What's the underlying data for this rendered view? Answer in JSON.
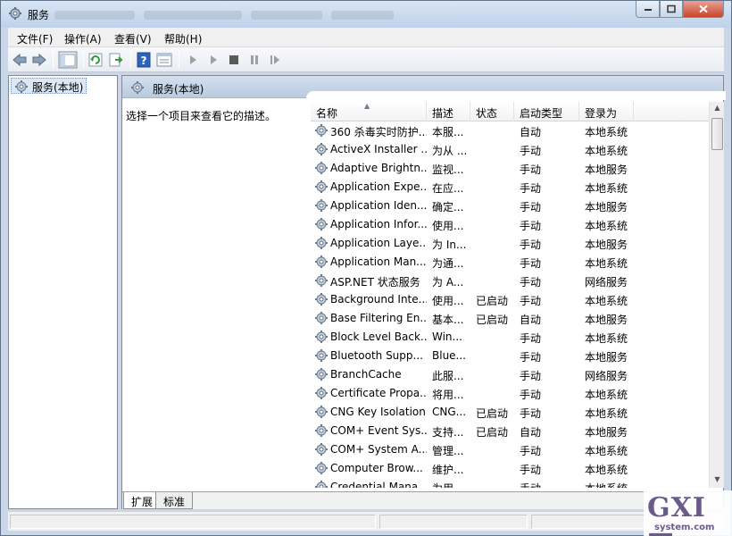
{
  "window": {
    "title": "服务"
  },
  "menu": [
    "文件(F)",
    "操作(A)",
    "查看(V)",
    "帮助(H)"
  ],
  "toolbar": [
    "back-icon",
    "forward-icon",
    "show-hide-console-tree-icon",
    "refresh-icon",
    "export-list-icon",
    "help-icon",
    "properties-icon",
    "start-service-icon",
    "start-service-alt-icon",
    "stop-service-icon",
    "pause-service-icon",
    "resume-service-icon"
  ],
  "tree": {
    "root_label": "服务(本地)"
  },
  "panel": {
    "title": "服务(本地)",
    "description_hint": "选择一个项目来查看它的描述。"
  },
  "columns": {
    "name": "名称",
    "desc": "描述",
    "status": "状态",
    "startup": "启动类型",
    "logon": "登录为"
  },
  "services": [
    {
      "name": "360 杀毒实时防护...",
      "desc": "本服...",
      "status": "",
      "startup": "自动",
      "logon": "本地系统"
    },
    {
      "name": "ActiveX Installer ...",
      "desc": "为从 ...",
      "status": "",
      "startup": "手动",
      "logon": "本地系统"
    },
    {
      "name": "Adaptive Brightn...",
      "desc": "监视...",
      "status": "",
      "startup": "手动",
      "logon": "本地服务"
    },
    {
      "name": "Application Expe...",
      "desc": "在应...",
      "status": "",
      "startup": "手动",
      "logon": "本地系统"
    },
    {
      "name": "Application Iden...",
      "desc": "确定...",
      "status": "",
      "startup": "手动",
      "logon": "本地服务"
    },
    {
      "name": "Application Infor...",
      "desc": "使用...",
      "status": "",
      "startup": "手动",
      "logon": "本地系统"
    },
    {
      "name": "Application Laye...",
      "desc": "为 In...",
      "status": "",
      "startup": "手动",
      "logon": "本地服务"
    },
    {
      "name": "Application Man...",
      "desc": "为通...",
      "status": "",
      "startup": "手动",
      "logon": "本地系统"
    },
    {
      "name": "ASP.NET 状态服务",
      "desc": "为 A...",
      "status": "",
      "startup": "手动",
      "logon": "网络服务"
    },
    {
      "name": "Background Inte...",
      "desc": "使用...",
      "status": "已启动",
      "startup": "手动",
      "logon": "本地系统"
    },
    {
      "name": "Base Filtering En...",
      "desc": "基本...",
      "status": "已启动",
      "startup": "自动",
      "logon": "本地服务"
    },
    {
      "name": "Block Level Back...",
      "desc": "Win...",
      "status": "",
      "startup": "手动",
      "logon": "本地系统"
    },
    {
      "name": "Bluetooth Supp...",
      "desc": "Blue...",
      "status": "",
      "startup": "手动",
      "logon": "本地服务"
    },
    {
      "name": "BranchCache",
      "desc": "此服...",
      "status": "",
      "startup": "手动",
      "logon": "网络服务"
    },
    {
      "name": "Certificate Propa...",
      "desc": "将用...",
      "status": "",
      "startup": "手动",
      "logon": "本地系统"
    },
    {
      "name": "CNG Key Isolation",
      "desc": "CNG...",
      "status": "已启动",
      "startup": "手动",
      "logon": "本地系统"
    },
    {
      "name": "COM+ Event Sys...",
      "desc": "支持...",
      "status": "已启动",
      "startup": "自动",
      "logon": "本地服务"
    },
    {
      "name": "COM+ System A...",
      "desc": "管理...",
      "status": "",
      "startup": "手动",
      "logon": "本地系统"
    },
    {
      "name": "Computer Brow...",
      "desc": "维护...",
      "status": "",
      "startup": "手动",
      "logon": "本地系统"
    },
    {
      "name": "Credential Mana...",
      "desc": "为用...",
      "status": "",
      "startup": "手动",
      "logon": "本地系统"
    }
  ],
  "tabs": [
    "扩展",
    "标准"
  ],
  "watermark": {
    "brand": "GXI网",
    "domain": "system.com"
  }
}
